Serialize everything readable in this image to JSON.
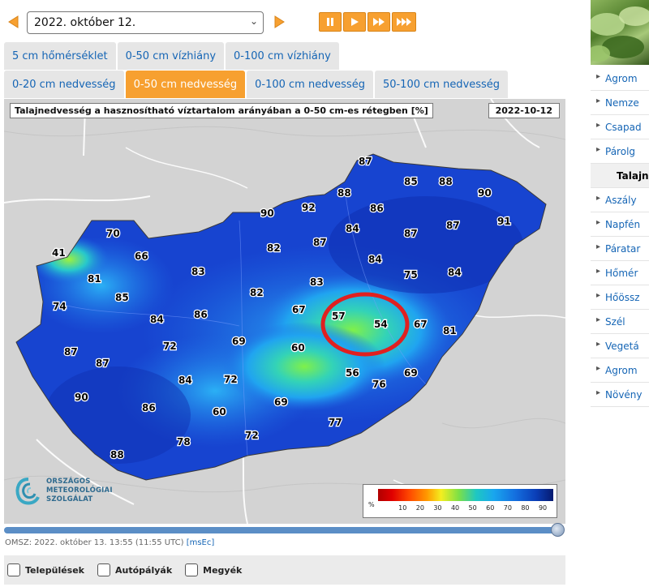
{
  "date_selector": {
    "value": "2022. október 12."
  },
  "tabs_row1": [
    "5 cm hőmérséklet",
    "0-50 cm vízhiány",
    "0-100 cm vízhiány"
  ],
  "tabs_row2": [
    "0-20 cm nedvesség",
    "0-50 cm nedvesség",
    "0-100 cm nedvesség",
    "50-100 cm nedvesség"
  ],
  "active_tab": "0-50 cm nedvesség",
  "map": {
    "title": "Talajnedvesség a hasznosítható víztartalom arányában a 0-50 cm-es rétegben [%]",
    "date": "2022-10-12",
    "values": [
      "87",
      "88",
      "85",
      "88",
      "90",
      "90",
      "92",
      "86",
      "91",
      "87",
      "84",
      "87",
      "70",
      "82",
      "87",
      "41",
      "66",
      "84",
      "83",
      "82",
      "83",
      "81",
      "75",
      "84",
      "74",
      "85",
      "67",
      "84",
      "86",
      "57",
      "54",
      "67",
      "81",
      "87",
      "72",
      "69",
      "60",
      "87",
      "56",
      "69",
      "84",
      "72",
      "76",
      "90",
      "86",
      "69",
      "60",
      "77",
      "72",
      "78",
      "88"
    ],
    "logo_lines": [
      "ORSZÁGOS",
      "METEOROLÓGIAI",
      "SZOLGÁLAT"
    ]
  },
  "legend": {
    "unit": "%",
    "ticks": [
      "10",
      "20",
      "30",
      "40",
      "50",
      "60",
      "70",
      "80",
      "90"
    ]
  },
  "footnote": {
    "text": "OMSZ: 2022. október 13. 13:55 (11:55 UTC)",
    "link": "[msEc]"
  },
  "checkboxes": [
    "Települések",
    "Autópályák",
    "Megyék"
  ],
  "sidebar": {
    "items": [
      "Agrom",
      "Nemze",
      "Csapad",
      "Párolg",
      "Talajne",
      "Aszály",
      "Napfén",
      "Páratar",
      "Hőmér",
      "Hőössz",
      "Szél",
      "Vegetá",
      "Agrom",
      "Növény"
    ],
    "active_index": 4
  },
  "colors": {
    "accent": "#f7a030",
    "link": "#1565b5",
    "highlight_circle": "#e02020"
  }
}
